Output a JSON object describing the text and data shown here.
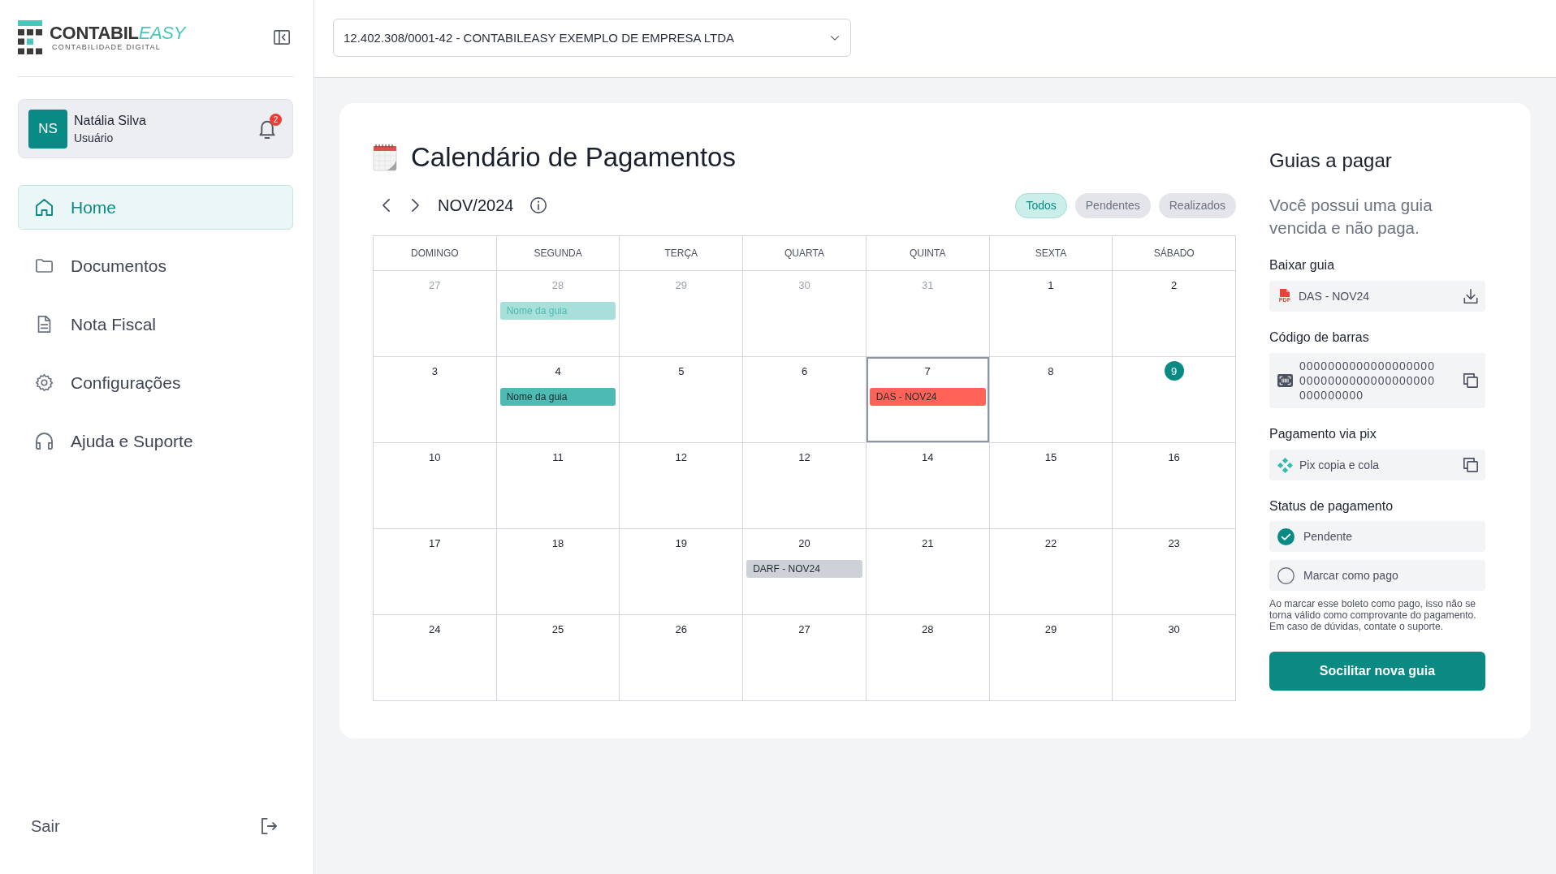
{
  "sidebar": {
    "logo": {
      "wordmark": "CONTABIL",
      "wordmark_accent": "EASY",
      "tagline": "CONTABILIDADE DIGITAL"
    },
    "user": {
      "initials": "NS",
      "name": "Natália Silva",
      "role": "Usuário",
      "notifications": "2"
    },
    "nav_items": [
      {
        "label": "Home",
        "selected": true
      },
      {
        "label": "Documentos",
        "selected": false
      },
      {
        "label": "Nota Fiscal",
        "selected": false
      },
      {
        "label": "Configurações",
        "selected": false
      },
      {
        "label": "Ajuda e Suporte",
        "selected": false
      }
    ],
    "logout": {
      "label": "Sair"
    }
  },
  "header": {
    "company_select": {
      "value": "12.402.308/0001-42 - CONTABILEASY EXEMPLO DE EMPRESA LTDA"
    }
  },
  "calendar": {
    "title": "Calendário de Pagamentos",
    "month": "NOV/2024",
    "filters": [
      {
        "label": "Todos",
        "selected": true
      },
      {
        "label": "Pendentes",
        "selected": false
      },
      {
        "label": "Realizados",
        "selected": false
      }
    ],
    "weekdays": [
      "DOMINGO",
      "SEGUNDA",
      "TERÇA",
      "QUARTA",
      "QUINTA",
      "SEXTA",
      "SÁBADO"
    ],
    "weeks": [
      {
        "days": [
          {
            "day": "27",
            "outside": true,
            "today": false,
            "selected": false
          },
          {
            "day": "28",
            "outside": true,
            "today": false,
            "selected": false,
            "events": [
              {
                "label": "Nome da guia",
                "color": "#a9dfdb"
              }
            ]
          },
          {
            "day": "29",
            "outside": true,
            "today": false,
            "selected": false
          },
          {
            "day": "30",
            "outside": true,
            "today": false,
            "selected": false
          },
          {
            "day": "31",
            "outside": true,
            "today": false,
            "selected": false
          },
          {
            "day": "1",
            "outside": false,
            "today": false,
            "selected": false
          },
          {
            "day": "2",
            "outside": false,
            "today": false,
            "selected": false
          }
        ]
      },
      {
        "days": [
          {
            "day": "3",
            "outside": false,
            "today": false,
            "selected": false
          },
          {
            "day": "4",
            "outside": false,
            "today": false,
            "selected": false,
            "events": [
              {
                "label": "Nome da guia",
                "color": "#4dbbb4"
              }
            ]
          },
          {
            "day": "5",
            "outside": false,
            "today": false,
            "selected": false
          },
          {
            "day": "6",
            "outside": false,
            "today": false,
            "selected": false
          },
          {
            "day": "7",
            "outside": false,
            "today": false,
            "selected": true,
            "events": [
              {
                "label": "DAS - NOV24",
                "color": "#ff6358"
              }
            ]
          },
          {
            "day": "8",
            "outside": false,
            "today": false,
            "selected": false
          },
          {
            "day": "9",
            "outside": false,
            "today": true,
            "selected": false
          }
        ]
      },
      {
        "days": [
          {
            "day": "10",
            "outside": false,
            "today": false,
            "selected": false
          },
          {
            "day": "11",
            "outside": false,
            "today": false,
            "selected": false
          },
          {
            "day": "12",
            "outside": false,
            "today": false,
            "selected": false
          },
          {
            "day": "12",
            "outside": false,
            "today": false,
            "selected": false
          },
          {
            "day": "14",
            "outside": false,
            "today": false,
            "selected": false
          },
          {
            "day": "15",
            "outside": false,
            "today": false,
            "selected": false
          },
          {
            "day": "16",
            "outside": false,
            "today": false,
            "selected": false
          }
        ]
      },
      {
        "days": [
          {
            "day": "17",
            "outside": false,
            "today": false,
            "selected": false
          },
          {
            "day": "18",
            "outside": false,
            "today": false,
            "selected": false
          },
          {
            "day": "19",
            "outside": false,
            "today": false,
            "selected": false
          },
          {
            "day": "20",
            "outside": false,
            "today": false,
            "selected": false,
            "events": [
              {
                "label": "DARF - NOV24",
                "color": "#cfd1d8"
              }
            ]
          },
          {
            "day": "21",
            "outside": false,
            "today": false,
            "selected": false
          },
          {
            "day": "22",
            "outside": false,
            "today": false,
            "selected": false
          },
          {
            "day": "23",
            "outside": false,
            "today": false,
            "selected": false
          }
        ]
      },
      {
        "days": [
          {
            "day": "24",
            "outside": false,
            "today": false,
            "selected": false
          },
          {
            "day": "25",
            "outside": false,
            "today": false,
            "selected": false
          },
          {
            "day": "26",
            "outside": false,
            "today": false,
            "selected": false
          },
          {
            "day": "27",
            "outside": false,
            "today": false,
            "selected": false
          },
          {
            "day": "28",
            "outside": false,
            "today": false,
            "selected": false
          },
          {
            "day": "29",
            "outside": false,
            "today": false,
            "selected": false
          },
          {
            "day": "30",
            "outside": false,
            "today": false,
            "selected": false
          }
        ]
      }
    ]
  },
  "payment_panel": {
    "title": "Guias a pagar",
    "message": "Você possui uma guia vencida e não paga.",
    "download": {
      "label": "Baixar guia",
      "file_type": "PDF",
      "file": "DAS - NOV24"
    },
    "barcode": {
      "label": "Código de barras",
      "value": "00000000000000000000000000000000000000000000000"
    },
    "pix": {
      "label": "Pagamento via pix",
      "value": "Pix copia e cola"
    },
    "status": {
      "label": "Status de pagamento",
      "options": [
        {
          "label": "Pendente",
          "selected": true
        },
        {
          "label": "Marcar como pago",
          "selected": false
        }
      ]
    },
    "note": "Ao marcar esse boleto como pago, isso não se torna válido como comprovante do pagamento. Em caso de dúvidas, contate o suporte.",
    "button": "Socilitar nova guia"
  }
}
